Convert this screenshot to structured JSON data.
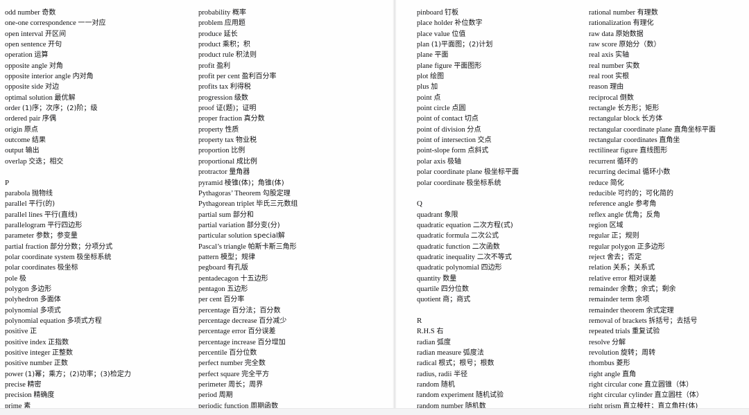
{
  "document": {
    "type": "mathematics-english-chinese-glossary",
    "layout": "two-page-scan-four-columns",
    "colors": {
      "page_background": "#ffffff",
      "text": "#111113",
      "seam": "#e3e3e4",
      "bottom_edge": "#f3f3f4"
    }
  },
  "columns": [
    {
      "id": "column-1",
      "entries": [
        {
          "term": "odd number",
          "gloss": "奇数"
        },
        {
          "term": "one-one correspondence",
          "gloss": "一一对应"
        },
        {
          "term": "open interval",
          "gloss": "开区间"
        },
        {
          "term": "open sentence",
          "gloss": "开句"
        },
        {
          "term": "operation",
          "gloss": "运算"
        },
        {
          "term": "opposite angle",
          "gloss": "对角"
        },
        {
          "term": "opposite interior angle",
          "gloss": "内对角"
        },
        {
          "term": "opposite side",
          "gloss": "对边"
        },
        {
          "term": "optimal solution",
          "gloss": "最优解"
        },
        {
          "term": "order",
          "gloss": "(1)序；次序；(2)阶；级"
        },
        {
          "term": "ordered pair",
          "gloss": "序偶"
        },
        {
          "term": "origin",
          "gloss": "原点"
        },
        {
          "term": "outcome",
          "gloss": "结果"
        },
        {
          "term": "output",
          "gloss": "输出"
        },
        {
          "term": "overlap",
          "gloss": "交迭；相交"
        },
        {
          "term": "",
          "gloss": ""
        },
        {
          "term": "P",
          "gloss": "",
          "section": true
        },
        {
          "term": "parabola",
          "gloss": "抛物线"
        },
        {
          "term": "parallel",
          "gloss": "平行(的)"
        },
        {
          "term": "parallel lines",
          "gloss": "平行(直线)"
        },
        {
          "term": "parallelogram",
          "gloss": "平行四边形"
        },
        {
          "term": "parameter",
          "gloss": "参数；参变量"
        },
        {
          "term": "partial fraction",
          "gloss": "部分分数；分项分式"
        },
        {
          "term": "polar coordinate system",
          "gloss": "极坐标系统"
        },
        {
          "term": "polar coordinates",
          "gloss": "极坐标"
        },
        {
          "term": "pole",
          "gloss": "极"
        },
        {
          "term": "polygon",
          "gloss": "多边形"
        },
        {
          "term": "polyhedron",
          "gloss": "多面体"
        },
        {
          "term": "polynomial",
          "gloss": "多项式"
        },
        {
          "term": "polynomial equation",
          "gloss": "多项式方程"
        },
        {
          "term": "positive",
          "gloss": "正"
        },
        {
          "term": "positive index",
          "gloss": "正指数"
        },
        {
          "term": "positive integer",
          "gloss": "正整数"
        },
        {
          "term": "positive number",
          "gloss": "正数"
        },
        {
          "term": "power",
          "gloss": "(1)幂；乘方；(2)功率；(3)检定力"
        },
        {
          "term": "precise",
          "gloss": "精密"
        },
        {
          "term": "precision",
          "gloss": "精确度"
        },
        {
          "term": "prime",
          "gloss": "素"
        }
      ]
    },
    {
      "id": "column-2",
      "entries": [
        {
          "term": "probability",
          "gloss": "概率"
        },
        {
          "term": "problem",
          "gloss": "应用题"
        },
        {
          "term": "produce",
          "gloss": "延长"
        },
        {
          "term": "product",
          "gloss": "乘积；积"
        },
        {
          "term": "product rule",
          "gloss": "积法则"
        },
        {
          "term": "profit",
          "gloss": "盈利"
        },
        {
          "term": "profit per cent",
          "gloss": "盈利百分率"
        },
        {
          "term": "profits tax",
          "gloss": "利得税"
        },
        {
          "term": "progression",
          "gloss": "级数"
        },
        {
          "term": "proof",
          "gloss": "证(题)；证明"
        },
        {
          "term": "proper fraction",
          "gloss": "真分数"
        },
        {
          "term": "property",
          "gloss": "性质"
        },
        {
          "term": "property tax",
          "gloss": "物业税"
        },
        {
          "term": "proportion",
          "gloss": "比例"
        },
        {
          "term": "proportional",
          "gloss": "成比例"
        },
        {
          "term": "protractor",
          "gloss": "量角器"
        },
        {
          "term": "pyramid",
          "gloss": "棱锥(体)；角锥(体)"
        },
        {
          "term": "Pythagoras’  Theorem",
          "gloss": "勾股定理"
        },
        {
          "term": "Pythagorean triplet",
          "gloss": "毕氏三元数组"
        },
        {
          "term": "partial sum",
          "gloss": "部分和"
        },
        {
          "term": "partial variation",
          "gloss": "部分变(分)"
        },
        {
          "term": "particular solution",
          "gloss": "special解"
        },
        {
          "term": "Pascal’s triangle",
          "gloss": "帕斯卡斯三角形"
        },
        {
          "term": "pattern",
          "gloss": "模型；规律"
        },
        {
          "term": "pegboard",
          "gloss": "有孔版"
        },
        {
          "term": "pentadecagon",
          "gloss": "十五边形"
        },
        {
          "term": "pentagon",
          "gloss": "五边形"
        },
        {
          "term": "per cent",
          "gloss": "百分率"
        },
        {
          "term": "percentage",
          "gloss": "百分法；百分数"
        },
        {
          "term": "percentage decrease",
          "gloss": "百分减少"
        },
        {
          "term": "percentage error",
          "gloss": "百分误差"
        },
        {
          "term": "percentage increase",
          "gloss": "百分增加"
        },
        {
          "term": "percentile",
          "gloss": "百分位数"
        },
        {
          "term": "perfect number",
          "gloss": "完全数"
        },
        {
          "term": "perfect square",
          "gloss": "完全平方"
        },
        {
          "term": "perimeter",
          "gloss": "周长；周界"
        },
        {
          "term": "period",
          "gloss": "周期"
        },
        {
          "term": "periodic function",
          "gloss": "周期函数"
        }
      ]
    },
    {
      "id": "column-3",
      "entries": [
        {
          "term": "pinboard",
          "gloss": "钉板"
        },
        {
          "term": "place holder",
          "gloss": "补位数字"
        },
        {
          "term": "place value",
          "gloss": "位值"
        },
        {
          "term": "plan",
          "gloss": "(1)平面图；(2)计划"
        },
        {
          "term": "plane",
          "gloss": "平面"
        },
        {
          "term": "plane figure",
          "gloss": "平面图形"
        },
        {
          "term": "plot",
          "gloss": "绘图"
        },
        {
          "term": "plus",
          "gloss": "加"
        },
        {
          "term": "point",
          "gloss": "点"
        },
        {
          "term": "point circle",
          "gloss": "点圆"
        },
        {
          "term": "point of contact",
          "gloss": "切点"
        },
        {
          "term": "point of division",
          "gloss": "分点"
        },
        {
          "term": "point of intersection",
          "gloss": "交点"
        },
        {
          "term": "point-slope form",
          "gloss": "点斜式"
        },
        {
          "term": "polar axis",
          "gloss": "极轴"
        },
        {
          "term": "polar coordinate plane",
          "gloss": "极坐标平面"
        },
        {
          "term": "polar coordinate",
          "gloss": "极坐标系统"
        },
        {
          "term": "",
          "gloss": ""
        },
        {
          "term": "Q",
          "gloss": "",
          "section": true
        },
        {
          "term": "quadrant",
          "gloss": "象限"
        },
        {
          "term": "quadratic equation",
          "gloss": "二次方程(式)"
        },
        {
          "term": "quadratic formula",
          "gloss": "二次公式"
        },
        {
          "term": "quadratic function",
          "gloss": "二次函数"
        },
        {
          "term": "quadratic inequality",
          "gloss": "二次不等式"
        },
        {
          "term": "quadratic polynomial",
          "gloss": "四边形"
        },
        {
          "term": "quantity",
          "gloss": "数量"
        },
        {
          "term": "quartile",
          "gloss": "四分位数"
        },
        {
          "term": "quotient",
          "gloss": "商；商式"
        },
        {
          "term": "",
          "gloss": ""
        },
        {
          "term": "R",
          "gloss": "",
          "section": true
        },
        {
          "term": "R.H.S",
          "gloss": "右"
        },
        {
          "term": "radian",
          "gloss": "弧度"
        },
        {
          "term": "radian measure",
          "gloss": "弧度法"
        },
        {
          "term": "radical",
          "gloss": "根式；根号；根数"
        },
        {
          "term": "radius, radii",
          "gloss": "半径"
        },
        {
          "term": "random",
          "gloss": "随机"
        },
        {
          "term": "random experiment",
          "gloss": "随机试验"
        },
        {
          "term": "random number",
          "gloss": "随机数"
        }
      ]
    },
    {
      "id": "column-4",
      "entries": [
        {
          "term": "rational number",
          "gloss": "有理数"
        },
        {
          "term": "rationalization",
          "gloss": "有理化"
        },
        {
          "term": "raw data",
          "gloss": "原始数据"
        },
        {
          "term": "raw score",
          "gloss": "原始分（数）"
        },
        {
          "term": "real axis",
          "gloss": "实轴"
        },
        {
          "term": "real number",
          "gloss": "实数"
        },
        {
          "term": "real root",
          "gloss": "实根"
        },
        {
          "term": "reason",
          "gloss": "理由"
        },
        {
          "term": "reciprocal",
          "gloss": "倒数"
        },
        {
          "term": "rectangle",
          "gloss": "长方形；矩形"
        },
        {
          "term": "rectangular block",
          "gloss": "长方体"
        },
        {
          "term": "rectangular coordinate plane",
          "gloss": "直角坐标平面"
        },
        {
          "term": "rectangular coordinates",
          "gloss": "直角坐"
        },
        {
          "term": "rectilinear figure",
          "gloss": "直线图形"
        },
        {
          "term": "recurrent",
          "gloss": "循环的"
        },
        {
          "term": "recurring decimal",
          "gloss": "循环小数"
        },
        {
          "term": "reduce",
          "gloss": "简化"
        },
        {
          "term": "reducible",
          "gloss": "可约的；可化简的"
        },
        {
          "term": "reference angle",
          "gloss": "参考角"
        },
        {
          "term": "reflex angle",
          "gloss": "优角；反角"
        },
        {
          "term": "region",
          "gloss": "区域"
        },
        {
          "term": "regular",
          "gloss": "正；规则"
        },
        {
          "term": "regular polygon",
          "gloss": "正多边形"
        },
        {
          "term": "reject",
          "gloss": "舍去；否定"
        },
        {
          "term": "relation",
          "gloss": "关系；关系式"
        },
        {
          "term": "relative error",
          "gloss": "相对误差"
        },
        {
          "term": "remainder",
          "gloss": "余数；余式；剩余"
        },
        {
          "term": "remainder term",
          "gloss": "余项"
        },
        {
          "term": "remainder theorem",
          "gloss": "余式定理"
        },
        {
          "term": "removal of brackets",
          "gloss": "拆括号；去括号"
        },
        {
          "term": "repeated trials",
          "gloss": "重复试验"
        },
        {
          "term": "resolve",
          "gloss": "分解"
        },
        {
          "term": "revolution",
          "gloss": "旋转；周转"
        },
        {
          "term": "rhombus",
          "gloss": "菱形"
        },
        {
          "term": "right angle",
          "gloss": "直角"
        },
        {
          "term": "right circular cone",
          "gloss": "直立圆锥（体）"
        },
        {
          "term": "right circular cylinder",
          "gloss": "直立圆柱（体）"
        },
        {
          "term": "right prism",
          "gloss": "直立棱柱；直立角柱(体)"
        }
      ]
    }
  ]
}
